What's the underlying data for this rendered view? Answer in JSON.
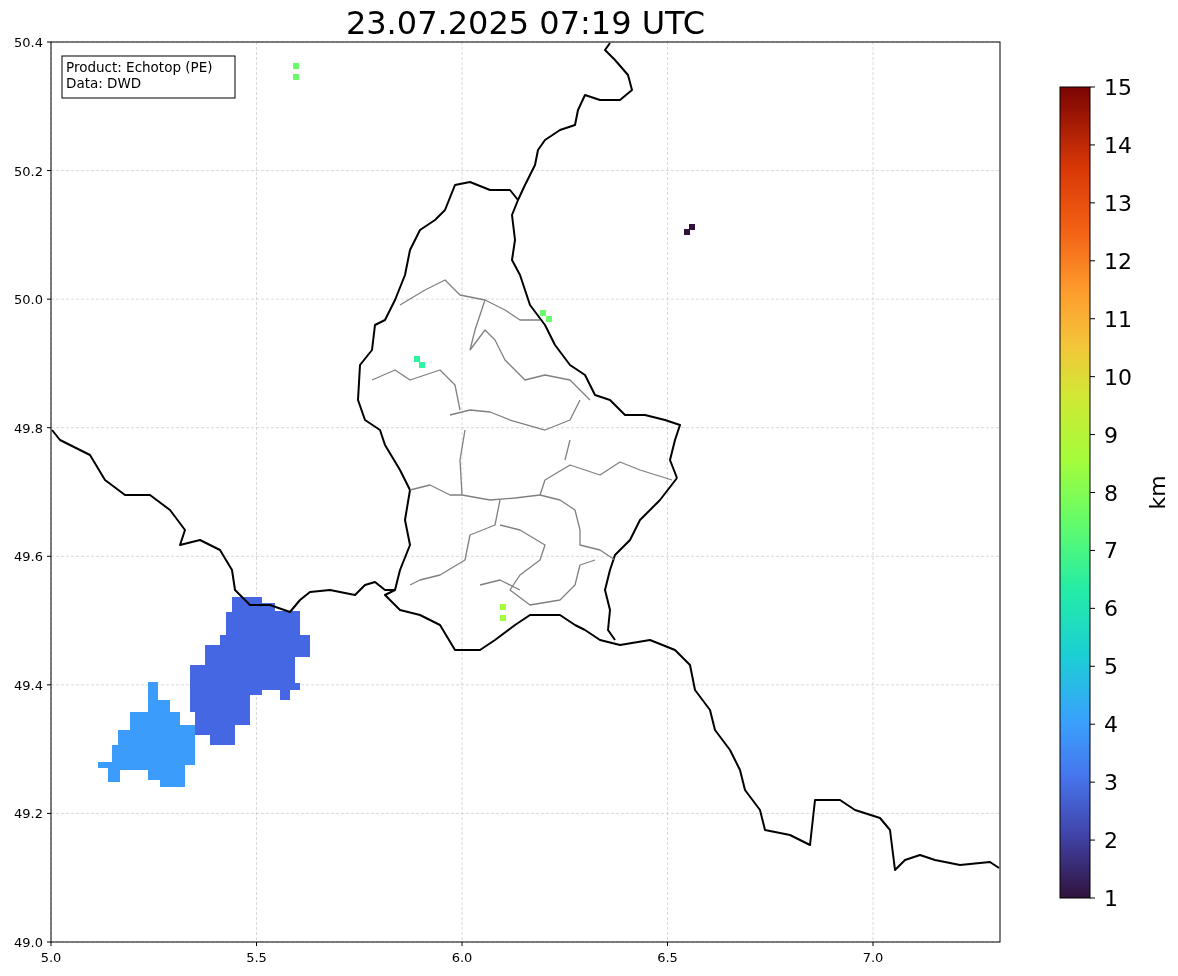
{
  "title": "23.07.2025 07:19 UTC",
  "info_box": [
    "Product: Echotop (PE)",
    "Data: DWD"
  ],
  "x_axis": {
    "ticks": [
      "5.0",
      "5.5",
      "6.0",
      "6.5",
      "7.0"
    ]
  },
  "y_axis": {
    "ticks": [
      "50.4",
      "50.2",
      "50.0",
      "49.8",
      "49.6",
      "49.4",
      "49.2",
      "49.0"
    ]
  },
  "colorbar": {
    "label": "km",
    "ticks": [
      "15",
      "14",
      "13",
      "12",
      "11",
      "10",
      "9",
      "8",
      "7",
      "6",
      "5",
      "4",
      "3",
      "2",
      "1"
    ]
  }
}
